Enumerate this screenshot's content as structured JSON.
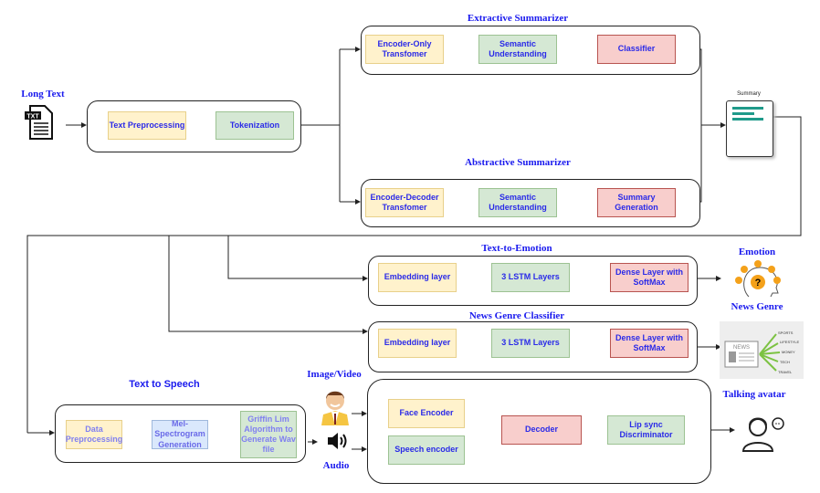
{
  "input": {
    "label": "Long Text",
    "icon": "txt-file-icon",
    "icon_text": "TXT"
  },
  "preprocess": {
    "steps": [
      "Text Preprocessing",
      "Tokenization"
    ]
  },
  "extractive": {
    "title": "Extractive Summarizer",
    "steps": [
      "Encoder-Only Transfomer",
      "Semantic Understanding",
      "Classifier"
    ]
  },
  "abstractive": {
    "title": "Abstractive Summarizer",
    "steps": [
      "Encoder-Decoder Transfomer",
      "Semantic Understanding",
      "Summary Generation"
    ]
  },
  "summary": {
    "label": "Summary",
    "icon": "summary-document-icon"
  },
  "emotion": {
    "title": "Text-to-Emotion",
    "steps": [
      "Embedding layer",
      "3 LSTM Layers",
      "Dense Layer with SoftMax"
    ],
    "output_label": "Emotion",
    "icon": "emotion-head-icon"
  },
  "genre": {
    "title": "News Genre Classifier",
    "steps": [
      "Embedding layer",
      "3 LSTM Layers",
      "Dense Layer with SoftMax"
    ],
    "output_label": "News Genre",
    "icon": "newspaper-genre-icon",
    "genre_tags": [
      "SPORTS",
      "LIFESTYLE",
      "MONEY",
      "TECH",
      "TRAVEL"
    ],
    "news_text": "NEWS"
  },
  "tts": {
    "title": "Text to Speech",
    "steps": [
      "Data Preprocessing",
      "Mel-Spectrogram Generation",
      "Griffin Lim Algorithm to Generate Wav file"
    ]
  },
  "avatar_inputs": {
    "image_label": "Image/Video",
    "audio_label": "Audio",
    "image_icon": "person-avatar-icon",
    "audio_icon": "speaker-icon"
  },
  "lipsync": {
    "steps": [
      "Face Encoder",
      "Speech encoder",
      "Decoder",
      "Lip sync Discriminator"
    ]
  },
  "output": {
    "label": "Talking avatar",
    "icon": "talking-avatar-icon"
  },
  "colors": {
    "yellow": "#fff2cc",
    "green": "#d5e8d4",
    "red": "#f8cecc",
    "blue": "#dae8fc",
    "text": "#1a1aee"
  }
}
